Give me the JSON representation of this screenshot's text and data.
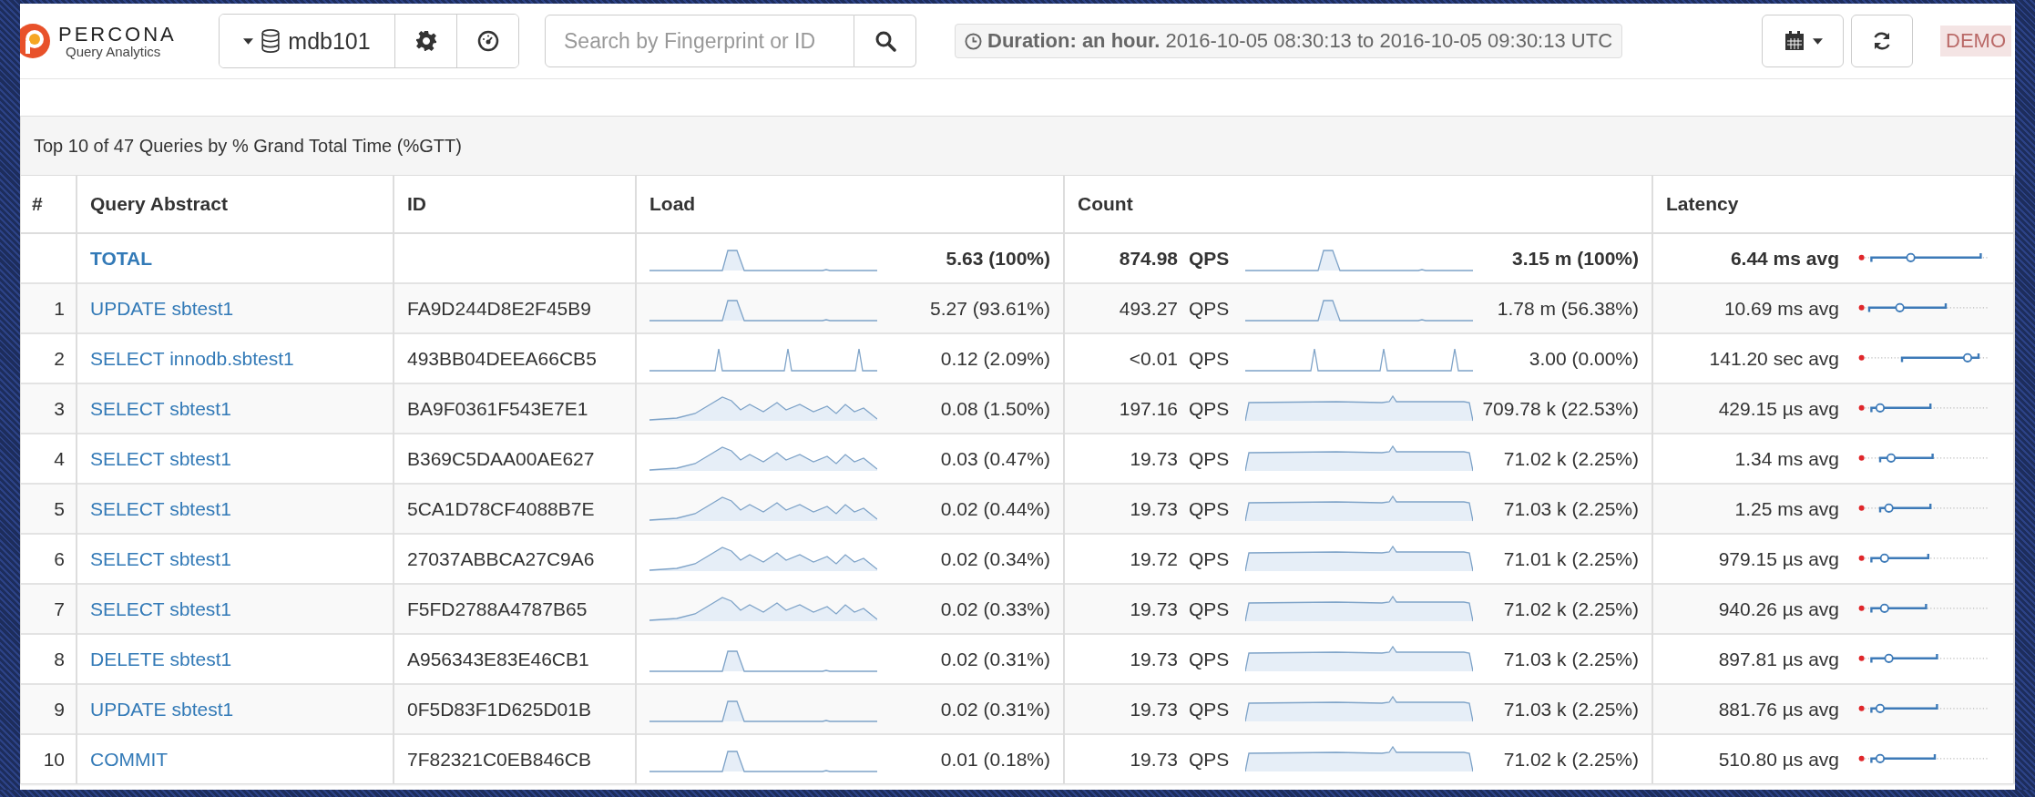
{
  "header": {
    "logo": {
      "name": "PERCONA",
      "subtitle": "Query Analytics"
    },
    "instance": "mdb101",
    "search": {
      "placeholder": "Search by Fingerprint or ID"
    },
    "duration": {
      "label": "Duration: an hour.",
      "range": "2016-10-05 08:30:13 to 2016-10-05 09:30:13 UTC"
    },
    "badge": "DEMO"
  },
  "panel": {
    "title": "Top 10 of 47 Queries by % Grand Total Time (%GTT)",
    "columns": [
      "#",
      "Query Abstract",
      "ID",
      "Load",
      "Count",
      "Latency"
    ],
    "total": {
      "query": "TOTAL",
      "load_chart": {
        "kind": "plateau"
      },
      "load": "5.63 (100%)",
      "qps": "874.98",
      "qps_unit": "QPS",
      "count_chart": {
        "kind": "plateau"
      },
      "count": "3.15 m (100%)",
      "latency": "6.44 ms avg"
    },
    "rows": [
      {
        "number": "1",
        "query": "UPDATE sbtest1",
        "id": "FA9D244D8E2F45B9",
        "load_chart": {
          "kind": "plateau"
        },
        "load": "5.27 (93.61%)",
        "qps": "493.27",
        "qps_unit": "QPS",
        "count_chart": {
          "kind": "plateau"
        },
        "count": "1.78 m (56.38%)",
        "latency": "10.69 ms avg"
      },
      {
        "number": "2",
        "query": "SELECT innodb.sbtest1",
        "id": "493BB04DEEA66CB5",
        "load_chart": {
          "kind": "spikes"
        },
        "load": "0.12 (2.09%)",
        "qps": "<0.01",
        "qps_unit": "QPS",
        "count_chart": {
          "kind": "spikes"
        },
        "count": "3.00 (0.00%)",
        "latency": "141.20 sec avg"
      },
      {
        "number": "3",
        "query": "SELECT sbtest1",
        "id": "BA9F0361F543E7E1",
        "load_chart": {
          "kind": "wavy"
        },
        "load": "0.08 (1.50%)",
        "qps": "197.16",
        "qps_unit": "QPS",
        "count_chart": {
          "kind": "flat"
        },
        "count": "709.78 k (22.53%)",
        "latency": "429.15 µs avg"
      },
      {
        "number": "4",
        "query": "SELECT sbtest1",
        "id": "B369C5DAA00AE627",
        "load_chart": {
          "kind": "wavy"
        },
        "load": "0.03 (0.47%)",
        "qps": "19.73",
        "qps_unit": "QPS",
        "count_chart": {
          "kind": "flat"
        },
        "count": "71.02 k (2.25%)",
        "latency": "1.34 ms avg"
      },
      {
        "number": "5",
        "query": "SELECT sbtest1",
        "id": "5CA1D78CF4088B7E",
        "load_chart": {
          "kind": "wavy"
        },
        "load": "0.02 (0.44%)",
        "qps": "19.73",
        "qps_unit": "QPS",
        "count_chart": {
          "kind": "flat"
        },
        "count": "71.03 k (2.25%)",
        "latency": "1.25 ms avg"
      },
      {
        "number": "6",
        "query": "SELECT sbtest1",
        "id": "27037ABBCA27C9A6",
        "load_chart": {
          "kind": "wavy"
        },
        "load": "0.02 (0.34%)",
        "qps": "19.72",
        "qps_unit": "QPS",
        "count_chart": {
          "kind": "flat"
        },
        "count": "71.01 k (2.25%)",
        "latency": "979.15 µs avg"
      },
      {
        "number": "7",
        "query": "SELECT sbtest1",
        "id": "F5FD2788A4787B65",
        "load_chart": {
          "kind": "wavy"
        },
        "load": "0.02 (0.33%)",
        "qps": "19.73",
        "qps_unit": "QPS",
        "count_chart": {
          "kind": "flat"
        },
        "count": "71.02 k (2.25%)",
        "latency": "940.26 µs avg"
      },
      {
        "number": "8",
        "query": "DELETE sbtest1",
        "id": "A956343E83E46CB1",
        "load_chart": {
          "kind": "plateau"
        },
        "load": "0.02 (0.31%)",
        "qps": "19.73",
        "qps_unit": "QPS",
        "count_chart": {
          "kind": "flat"
        },
        "count": "71.03 k (2.25%)",
        "latency": "897.81 µs avg"
      },
      {
        "number": "9",
        "query": "UPDATE sbtest1",
        "id": "0F5D83F1D625D01B",
        "load_chart": {
          "kind": "plateau"
        },
        "load": "0.02 (0.31%)",
        "qps": "19.73",
        "qps_unit": "QPS",
        "count_chart": {
          "kind": "flat"
        },
        "count": "71.03 k (2.25%)",
        "latency": "881.76 µs avg"
      },
      {
        "number": "10",
        "query": "COMMIT",
        "id": "7F82321C0EB846CB",
        "load_chart": {
          "kind": "plateau"
        },
        "load": "0.01 (0.18%)",
        "qps": "19.73",
        "qps_unit": "QPS",
        "count_chart": {
          "kind": "flat"
        },
        "count": "71.02 k (2.25%)",
        "latency": "510.80 µs avg"
      }
    ]
  }
}
